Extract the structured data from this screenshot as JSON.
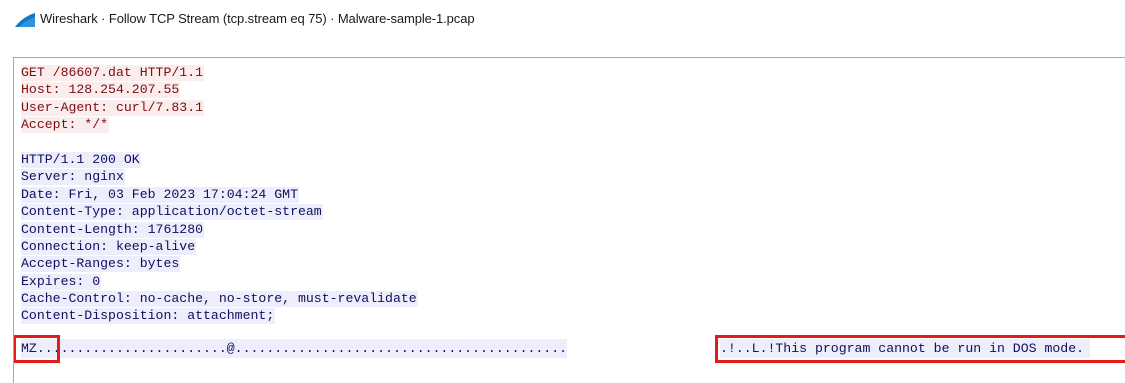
{
  "window": {
    "title": "Wireshark · Follow TCP Stream (tcp.stream eq 75) · Malware-sample-1.pcap",
    "icon": "wireshark-fin-icon",
    "icon_color": "#1679c5"
  },
  "stream": {
    "client_color": "#7a0f0f",
    "client_bg": "#fbeded",
    "server_color": "#101060",
    "server_bg": "#ededfb",
    "request_lines": [
      "GET /86607.dat HTTP/1.1",
      "Host: 128.254.207.55",
      "User-Agent: curl/7.83.1",
      "Accept: */*"
    ],
    "response_lines": [
      "HTTP/1.1 200 OK",
      "Server: nginx",
      "Date: Fri, 03 Feb 2023 17:04:24 GMT",
      "Content-Type: application/octet-stream",
      "Content-Length: 1761280",
      "Connection: keep-alive",
      "Accept-Ranges: bytes",
      "Expires: 0",
      "Cache-Control: no-cache, no-store, must-revalidate",
      "Content-Disposition: attachment;"
    ],
    "binary_left": "MZ........................@..........................................",
    "binary_right": ".!..L.!This program cannot be run in DOS mode.",
    "highlight_color": "#e21b1b"
  }
}
